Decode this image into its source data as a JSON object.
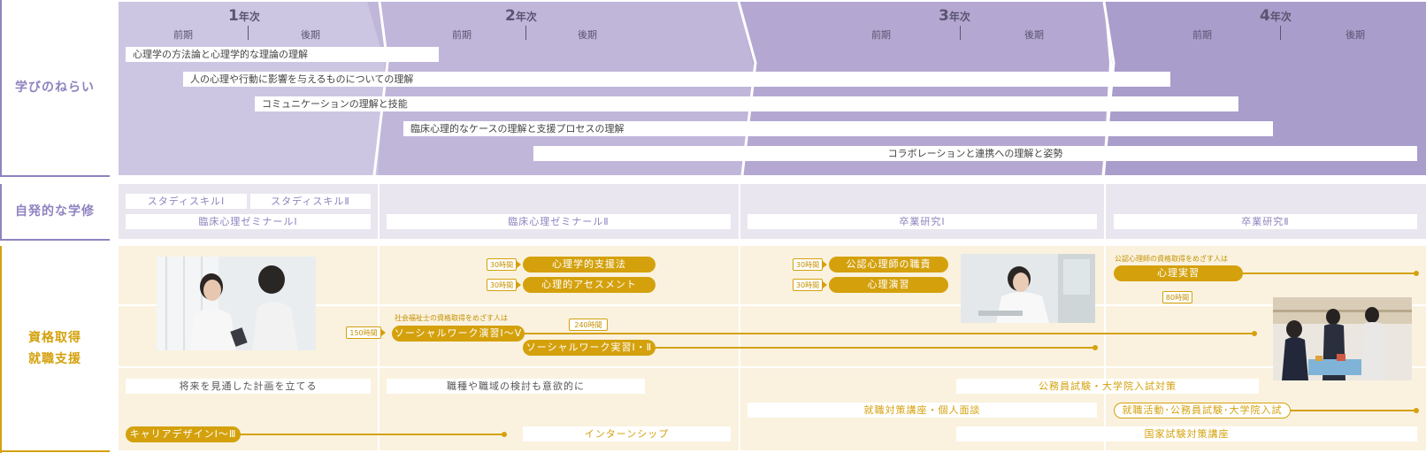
{
  "colors": {
    "purple": "#8f83bf",
    "gold": "#d4a10d"
  },
  "row_labels": {
    "aims": "学びのねらい",
    "self": "自発的な学修",
    "career": [
      "資格取得",
      "就職支援"
    ]
  },
  "years": [
    {
      "num": "1",
      "unit": "年次",
      "first": "前期",
      "second": "後期"
    },
    {
      "num": "2",
      "unit": "年次",
      "first": "前期",
      "second": "後期"
    },
    {
      "num": "3",
      "unit": "年次",
      "first": "前期",
      "second": "後期"
    },
    {
      "num": "4",
      "unit": "年次",
      "first": "前期",
      "second": "後期"
    }
  ],
  "aims": [
    "心理学の方法論と心理学的な理論の理解",
    "人の心理や行動に影響を与えるものについての理解",
    "コミュニケーションの理解と技能",
    "臨床心理的なケースの理解と支援プロセスの理解",
    "コラボレーションと連携への理解と姿勢"
  ],
  "self_study": {
    "skill1": "スタディスキルⅠ",
    "skill2": "スタディスキルⅡ",
    "seminar1": "臨床心理ゼミナールⅠ",
    "seminar2": "臨床心理ゼミナールⅡ",
    "thesis1": "卒業研究Ⅰ",
    "thesis2": "卒業研究Ⅱ"
  },
  "career": {
    "support_method": {
      "hours": "30時間",
      "label": "心理学的支援法"
    },
    "assessment": {
      "hours": "30時間",
      "label": "心理的アセスメント"
    },
    "duties": {
      "hours": "30時間",
      "label": "公認心理師の職責"
    },
    "exercise": {
      "hours": "30時間",
      "label": "心理演習"
    },
    "practice_note": "公認心理師の資格取得をめざす人は",
    "practice": {
      "label": "心理実習",
      "hours": "80時間"
    },
    "sw_note": "社会福祉士の資格取得をめざす人は",
    "sw_exercise": {
      "hours": "150時間",
      "label": "ソーシャルワーク演習Ⅰ～Ⅴ"
    },
    "sw_practice": {
      "hours": "240時間",
      "label": "ソーシャルワーク実習Ⅰ・Ⅱ"
    },
    "plan": "将来を見通した計画を立てる",
    "job_types": "職種や職域の検討も意欲的に",
    "civil": "公務員試験・大学院入試対策",
    "job_course": "就職対策講座・個人面談",
    "job_hunting": "就職活動･公務員試験･大学院入試",
    "career_design": "キャリアデザインⅠ～Ⅲ",
    "internship": "インターンシップ",
    "national_exam": "国家試験対策講座"
  }
}
